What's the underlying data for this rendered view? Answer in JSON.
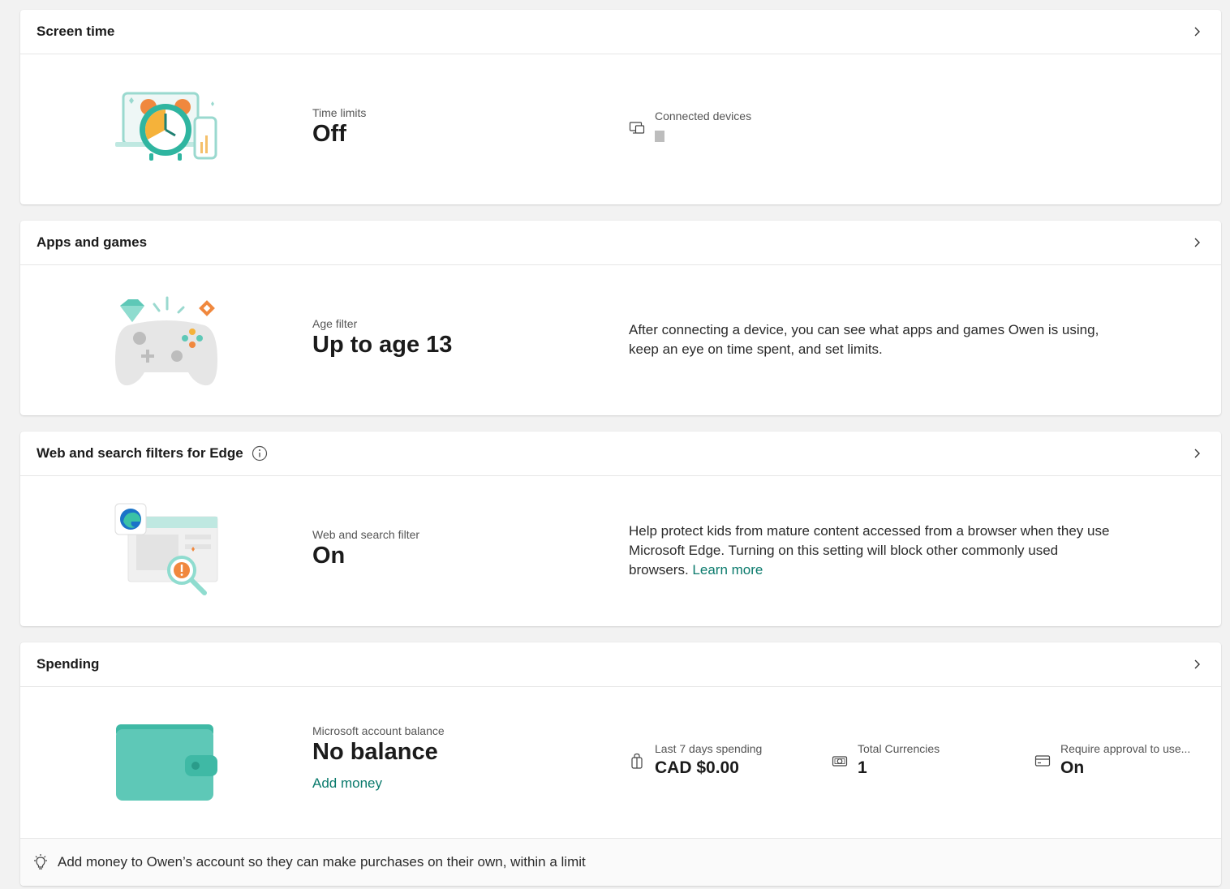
{
  "screen_time": {
    "title": "Screen time",
    "time_limits_label": "Time limits",
    "time_limits_value": "Off",
    "connected_devices_label": "Connected devices",
    "icon": "devices-icon"
  },
  "apps_games": {
    "title": "Apps and games",
    "age_filter_label": "Age filter",
    "age_filter_value": "Up to age 13",
    "description": "After connecting a device, you can see what apps and games Owen is using, keep an eye on time spent, and set limits."
  },
  "web_filters": {
    "title": "Web and search filters for Edge",
    "filter_label": "Web and search filter",
    "filter_value": "On",
    "description": "Help protect kids from mature content accessed from a browser when they use Microsoft Edge. Turning on this setting will block other commonly used browsers.",
    "learn_more": "Learn more"
  },
  "spending": {
    "title": "Spending",
    "balance_label": "Microsoft account balance",
    "balance_value": "No balance",
    "add_money": "Add money",
    "last7_label": "Last 7 days spending",
    "last7_value": "CAD $0.00",
    "currencies_label": "Total Currencies",
    "currencies_value": "1",
    "approval_label": "Require approval to use...",
    "approval_value": "On",
    "tip": "Add money to Owen’s account so they can make purchases on their own, within a limit"
  },
  "colors": {
    "accent": "#0a7a6c",
    "teal": "#5ec8b7",
    "orange": "#f0883e"
  }
}
